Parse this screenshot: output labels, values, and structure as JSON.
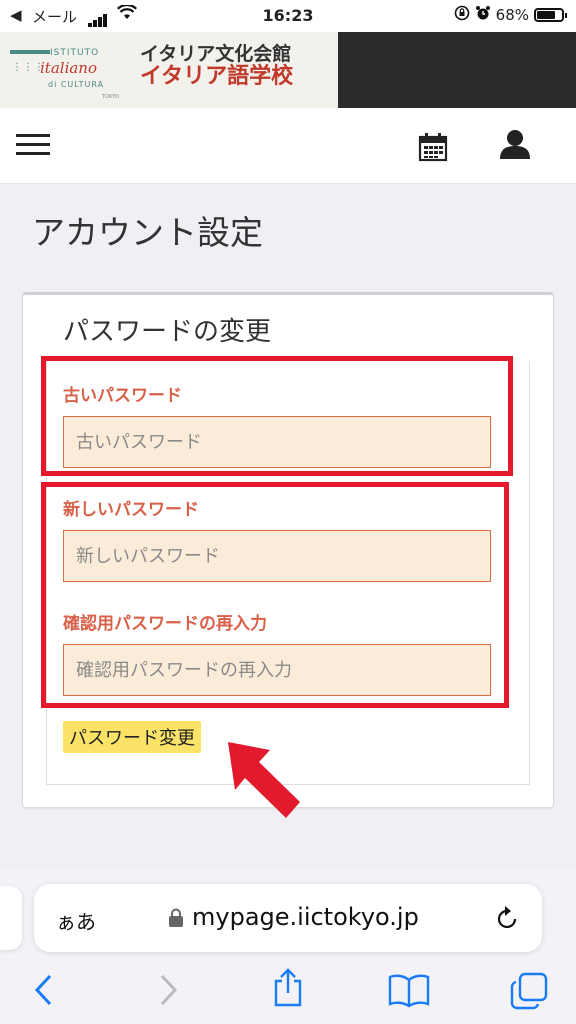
{
  "status": {
    "back": "◀",
    "carrier": "メール",
    "time": "16:23",
    "battery": "68%",
    "battery_level": 0.68
  },
  "banner": {
    "logo": {
      "line1": "ISTITUTO",
      "line2": "italiano",
      "line3": "di CULTURA",
      "line4": "TOKYO"
    },
    "title": "イタリア文化会館",
    "subtitle": "イタリア語学校"
  },
  "page": {
    "title": "アカウント設定"
  },
  "card": {
    "title": "パスワードの変更",
    "old_password": {
      "label": "古いパスワード",
      "placeholder": "古いパスワード"
    },
    "new_password": {
      "label": "新しいパスワード",
      "placeholder": "新しいパスワード"
    },
    "confirm_password": {
      "label": "確認用パスワードの再入力",
      "placeholder": "確認用パスワードの再入力"
    },
    "submit_label": "パスワード変更"
  },
  "annotation": {
    "highlight_color": "#e3192d",
    "arrow_color": "#e3192d"
  },
  "browser": {
    "aa_label": "ぁあ",
    "url": "mypage.iictokyo.jp"
  }
}
